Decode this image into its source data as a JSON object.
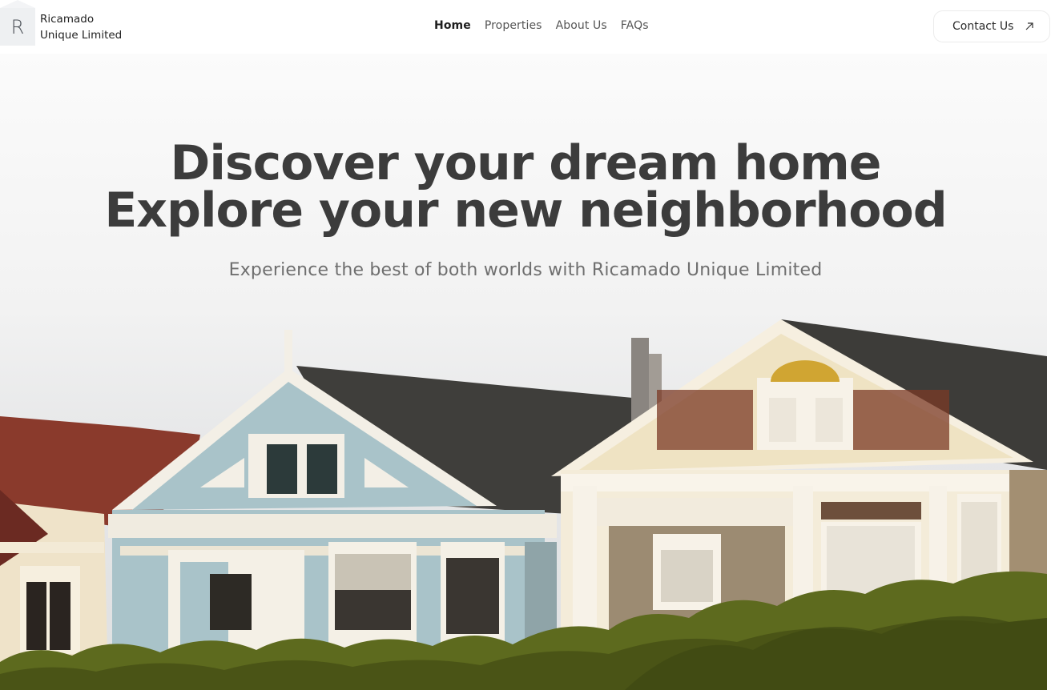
{
  "brand": {
    "logo_letter": "R",
    "name_line1": "Ricamado",
    "name_line2": "Unique Limited"
  },
  "nav": {
    "items": [
      {
        "label": "Home",
        "active": true
      },
      {
        "label": "Properties",
        "active": false
      },
      {
        "label": "About Us",
        "active": false
      },
      {
        "label": "FAQs",
        "active": false
      }
    ]
  },
  "contact": {
    "label": "Contact Us",
    "icon": "arrow-up-right-icon"
  },
  "hero": {
    "headline_line1": "Discover your dream home",
    "headline_line2": "Explore your new neighborhood",
    "subheadline": "Experience the best of both worlds with Ricamado Unique Limited",
    "image": "victorian-houses-photo"
  },
  "colors": {
    "headline": "#3c3c3c",
    "roof_dark": "#3f3e3b",
    "roof_red": "#8a3a2c",
    "house_blue": "#a9c3c9",
    "house_cream": "#f1e3c0",
    "house_tan": "#9c8b72",
    "hedge": "#5d6a1e"
  }
}
